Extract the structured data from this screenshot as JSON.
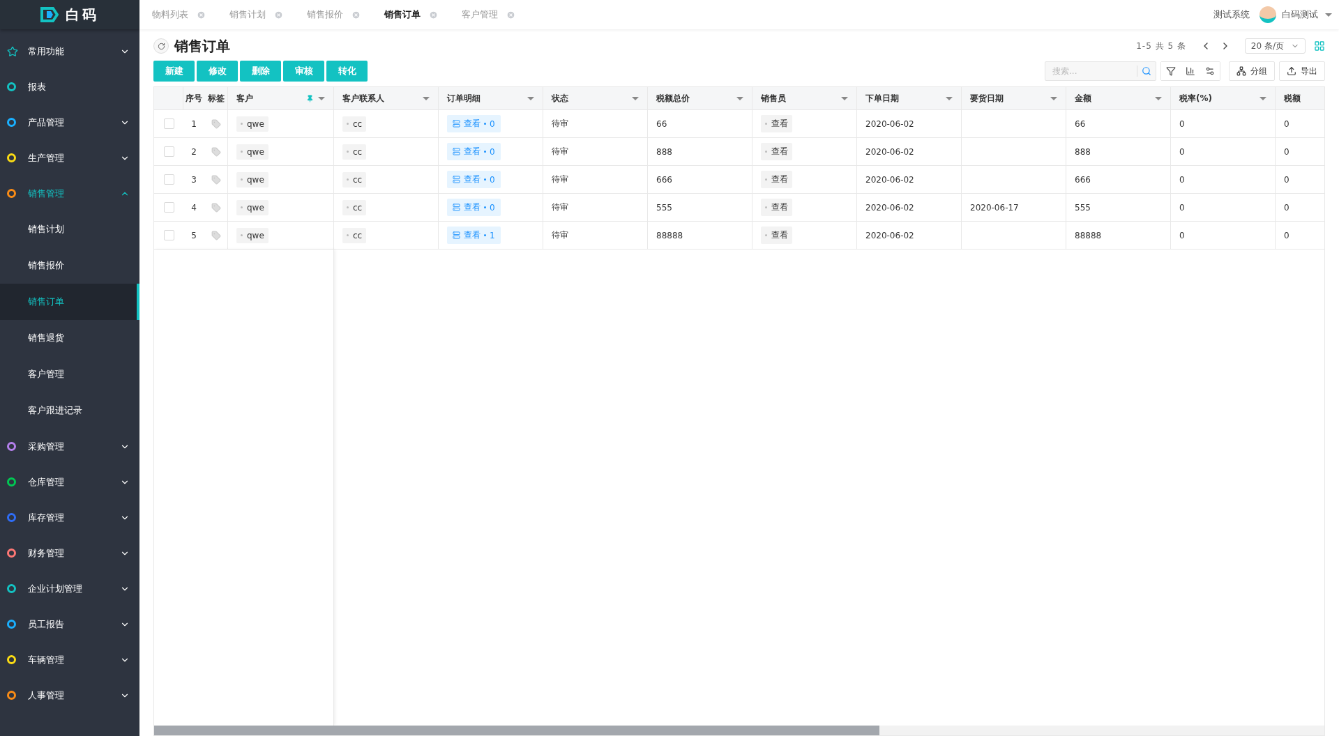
{
  "logo": {
    "text": "白码"
  },
  "sidebar": {
    "items": [
      {
        "label": "常用功能",
        "kind": "star",
        "color": "#13c2c2",
        "expanded": false
      },
      {
        "label": "报表",
        "kind": "dot",
        "color": "#13c2c2"
      },
      {
        "label": "产品管理",
        "kind": "dot",
        "color": "#1ab0ff",
        "expanded": false
      },
      {
        "label": "生产管理",
        "kind": "dot",
        "color": "#fadb14",
        "expanded": false
      },
      {
        "label": "销售管理",
        "kind": "dot",
        "color": "#fa8c16",
        "expanded": true,
        "children": [
          {
            "label": "销售计划",
            "selected": false
          },
          {
            "label": "销售报价",
            "selected": false
          },
          {
            "label": "销售订单",
            "selected": true
          },
          {
            "label": "销售退货",
            "selected": false
          },
          {
            "label": "客户管理",
            "selected": false
          },
          {
            "label": "客户跟进记录",
            "selected": false
          }
        ]
      },
      {
        "label": "采购管理",
        "kind": "dot",
        "color": "#b37feb",
        "expanded": false
      },
      {
        "label": "仓库管理",
        "kind": "dot",
        "color": "#00c853",
        "expanded": false
      },
      {
        "label": "库存管理",
        "kind": "dot",
        "color": "#2f6df6",
        "expanded": false
      },
      {
        "label": "财务管理",
        "kind": "dot",
        "color": "#ff7875",
        "expanded": false
      },
      {
        "label": "企业计划管理",
        "kind": "dot",
        "color": "#13c2c2",
        "expanded": false
      },
      {
        "label": "员工报告",
        "kind": "dot",
        "color": "#1ab0ff",
        "expanded": false
      },
      {
        "label": "车辆管理",
        "kind": "dot",
        "color": "#fadb14",
        "expanded": false
      },
      {
        "label": "人事管理",
        "kind": "dot",
        "color": "#fa8c16",
        "expanded": false
      }
    ]
  },
  "tabs": [
    {
      "label": "物料列表",
      "selected": false
    },
    {
      "label": "销售计划",
      "selected": false
    },
    {
      "label": "销售报价",
      "selected": false
    },
    {
      "label": "销售订单",
      "selected": true
    },
    {
      "label": "客户管理",
      "selected": false
    }
  ],
  "header": {
    "system": "测试系统",
    "user": "白码测试"
  },
  "page": {
    "title": "销售订单",
    "pagination": "1-5 共 5 条",
    "page_size": "20 条/页"
  },
  "actions": [
    "新建",
    "修改",
    "删除",
    "审核",
    "转化"
  ],
  "search": {
    "placeholder": "搜索..."
  },
  "tools": [
    {
      "label": "分组",
      "kind": "group"
    },
    {
      "label": "导出",
      "kind": "export"
    }
  ],
  "table": {
    "index_header": "序号",
    "tag_header": "标签",
    "columns": [
      {
        "label": "客户",
        "pinned": true
      },
      {
        "label": "客户联系人",
        "pinned": false
      },
      {
        "label": "订单明细",
        "pinned": false
      },
      {
        "label": "状态",
        "pinned": false
      },
      {
        "label": "税额总价",
        "pinned": false
      },
      {
        "label": "销售员",
        "pinned": false
      },
      {
        "label": "下单日期",
        "pinned": false
      },
      {
        "label": "要货日期",
        "pinned": false
      },
      {
        "label": "金额",
        "pinned": false
      },
      {
        "label": "税率(%)",
        "pinned": false
      },
      {
        "label": "税额",
        "pinned": false
      }
    ],
    "rows": [
      {
        "checked": false,
        "index": "1",
        "customer": "qwe",
        "contact": "cc",
        "detail": {
          "label": "查看",
          "count": "0"
        },
        "status": "待审",
        "tax_total": "66",
        "salesperson": "查看",
        "order_date": "2020-06-02",
        "delivery_date": "",
        "amount": "66",
        "tax_rate": "0",
        "tax": "0"
      },
      {
        "checked": false,
        "index": "2",
        "customer": "qwe",
        "contact": "cc",
        "detail": {
          "label": "查看",
          "count": "0"
        },
        "status": "待审",
        "tax_total": "888",
        "salesperson": "查看",
        "order_date": "2020-06-02",
        "delivery_date": "",
        "amount": "888",
        "tax_rate": "0",
        "tax": "0"
      },
      {
        "checked": false,
        "index": "3",
        "customer": "qwe",
        "contact": "cc",
        "detail": {
          "label": "查看",
          "count": "0"
        },
        "status": "待审",
        "tax_total": "666",
        "salesperson": "查看",
        "order_date": "2020-06-02",
        "delivery_date": "",
        "amount": "666",
        "tax_rate": "0",
        "tax": "0"
      },
      {
        "checked": false,
        "index": "4",
        "customer": "qwe",
        "contact": "cc",
        "detail": {
          "label": "查看",
          "count": "0"
        },
        "status": "待审",
        "tax_total": "555",
        "salesperson": "查看",
        "order_date": "2020-06-02",
        "delivery_date": "2020-06-17",
        "amount": "555",
        "tax_rate": "0",
        "tax": "0"
      },
      {
        "checked": false,
        "index": "5",
        "customer": "qwe",
        "contact": "cc",
        "detail": {
          "label": "查看",
          "count": "1"
        },
        "status": "待审",
        "tax_total": "88888",
        "salesperson": "查看",
        "order_date": "2020-06-02",
        "delivery_date": "",
        "amount": "88888",
        "tax_rate": "0",
        "tax": "0"
      }
    ]
  }
}
